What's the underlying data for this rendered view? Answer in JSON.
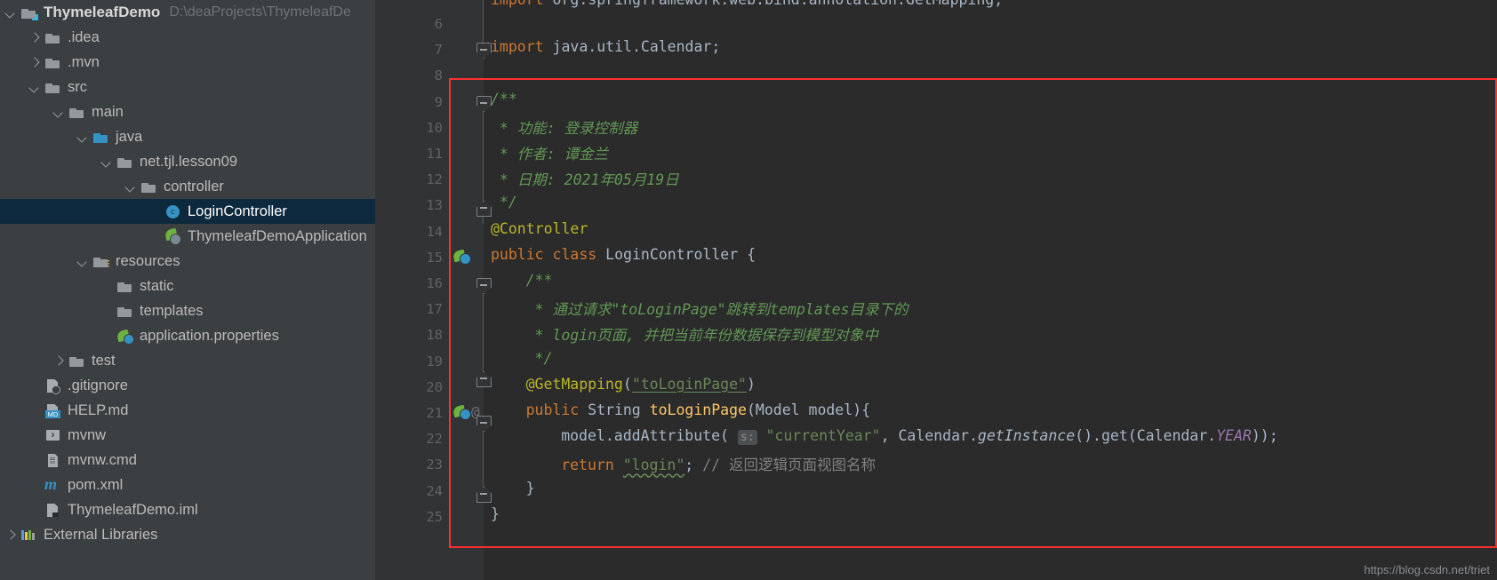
{
  "sidebar": {
    "items": [
      {
        "label": "ThymeleafDemo",
        "path": "D:\\deaProjects\\ThymeleafDe",
        "indent": 0,
        "arrow": "open",
        "icon": "folder-module-icon",
        "kind": "root"
      },
      {
        "label": ".idea",
        "path": "",
        "indent": 1,
        "arrow": "closed",
        "icon": "folder-icon",
        "kind": "folder"
      },
      {
        "label": ".mvn",
        "path": "",
        "indent": 1,
        "arrow": "closed",
        "icon": "folder-icon",
        "kind": "folder"
      },
      {
        "label": "src",
        "path": "",
        "indent": 1,
        "arrow": "open",
        "icon": "folder-icon",
        "kind": "folder"
      },
      {
        "label": "main",
        "path": "",
        "indent": 2,
        "arrow": "open",
        "icon": "folder-icon",
        "kind": "folder"
      },
      {
        "label": "java",
        "path": "",
        "indent": 3,
        "arrow": "open",
        "icon": "folder-source-icon",
        "kind": "folder-blue"
      },
      {
        "label": "net.tjl.lesson09",
        "path": "",
        "indent": 4,
        "arrow": "open",
        "icon": "package-icon",
        "kind": "package"
      },
      {
        "label": "controller",
        "path": "",
        "indent": 5,
        "arrow": "open",
        "icon": "package-icon",
        "kind": "package"
      },
      {
        "label": "LoginController",
        "path": "",
        "indent": 6,
        "arrow": "none",
        "icon": "java-class-icon",
        "kind": "class",
        "selected": true
      },
      {
        "label": "ThymeleafDemoApplication",
        "path": "",
        "indent": 6,
        "arrow": "none",
        "icon": "spring-boot-run-icon",
        "kind": "spring-run"
      },
      {
        "label": "resources",
        "path": "",
        "indent": 3,
        "arrow": "open",
        "icon": "folder-resources-icon",
        "kind": "resources"
      },
      {
        "label": "static",
        "path": "",
        "indent": 4,
        "arrow": "none",
        "icon": "folder-icon",
        "kind": "folder"
      },
      {
        "label": "templates",
        "path": "",
        "indent": 4,
        "arrow": "none",
        "icon": "folder-icon",
        "kind": "folder"
      },
      {
        "label": "application.properties",
        "path": "",
        "indent": 4,
        "arrow": "none",
        "icon": "spring-properties-icon",
        "kind": "spring"
      },
      {
        "label": "test",
        "path": "",
        "indent": 2,
        "arrow": "closed",
        "icon": "folder-icon",
        "kind": "folder"
      },
      {
        "label": ".gitignore",
        "path": "",
        "indent": 1,
        "arrow": "none",
        "icon": "gitignore-file-icon",
        "kind": "git"
      },
      {
        "label": "HELP.md",
        "path": "",
        "indent": 1,
        "arrow": "none",
        "icon": "markdown-file-icon",
        "kind": "md"
      },
      {
        "label": "mvnw",
        "path": "",
        "indent": 1,
        "arrow": "none",
        "icon": "shell-script-icon",
        "kind": "sh"
      },
      {
        "label": "mvnw.cmd",
        "path": "",
        "indent": 1,
        "arrow": "none",
        "icon": "cmd-file-icon",
        "kind": "cmd"
      },
      {
        "label": "pom.xml",
        "path": "",
        "indent": 1,
        "arrow": "none",
        "icon": "maven-pom-icon",
        "kind": "maven"
      },
      {
        "label": "ThymeleafDemo.iml",
        "path": "",
        "indent": 1,
        "arrow": "none",
        "icon": "iml-file-icon",
        "kind": "iml"
      },
      {
        "label": "External Libraries",
        "path": "",
        "indent": 0,
        "arrow": "closed",
        "icon": "libraries-icon",
        "kind": "libs"
      }
    ]
  },
  "editor": {
    "line_numbers": [
      "6",
      "7",
      "8",
      "9",
      "10",
      "11",
      "12",
      "13",
      "14",
      "15",
      "16",
      "17",
      "18",
      "19",
      "20",
      "21",
      "22",
      "23",
      "24",
      "25"
    ],
    "first_visible_line": 6,
    "gutter_icons": [
      {
        "line": 15,
        "name": "spring-bean-gutter-icon"
      },
      {
        "line": 21,
        "name": "spring-mapping-gutter-icon"
      },
      {
        "line": 21,
        "name": "annotation-gutter-marker"
      }
    ],
    "lines": {
      "l7": "import java.util.Calendar;",
      "l9": "/**",
      "l10": " * 功能: 登录控制器",
      "l11": " * 作者: 谭金兰",
      "l12": " * 日期: 2021年05月19日",
      "l13": " */",
      "l14": "@Controller",
      "l15_kw1": "public",
      "l15_kw2": "class",
      "l15_name": "LoginController",
      "l15_brace": "{",
      "l16": "/**",
      "l17": " * 通过请求\"toLoginPage\"跳转到templates目录下的",
      "l18": " * login页面, 并把当前年份数据保存到模型对象中",
      "l19": " */",
      "l20_anno": "@GetMapping",
      "l20_str": "\"toLoginPage\"",
      "l21_kw": "public",
      "l21_type": "String",
      "l21_mth": "toLoginPage",
      "l21_params": "(Model model){",
      "l22_obj": "model.addAttribute(",
      "l22_hint": "s:",
      "l22_str": "\"currentYear\"",
      "l22_rest": ", Calendar.",
      "l22_getinstance": "getInstance",
      "l22_mid": "().get(Calendar.",
      "l22_year": "YEAR",
      "l22_end": "));",
      "l23_kw": "return",
      "l23_str": "\"login\"",
      "l23_semi": ";",
      "l23_cmt": "// 返回逻辑页面视图名称",
      "l24": "}",
      "l25": "}"
    }
  },
  "watermark": "https://blog.csdn.net/triet",
  "colors": {
    "sidebar_bg": "#3c3f41",
    "editor_bg": "#2b2b2b",
    "gutter_bg": "#313335",
    "selection": "#0d293e",
    "highlight_box": "#ff2f2f",
    "keyword": "#cc7832",
    "string": "#6a8759",
    "comment": "#629755",
    "annotation": "#bbb529",
    "method": "#ffc66d",
    "field": "#9876aa",
    "default_text": "#a9b7c6"
  }
}
